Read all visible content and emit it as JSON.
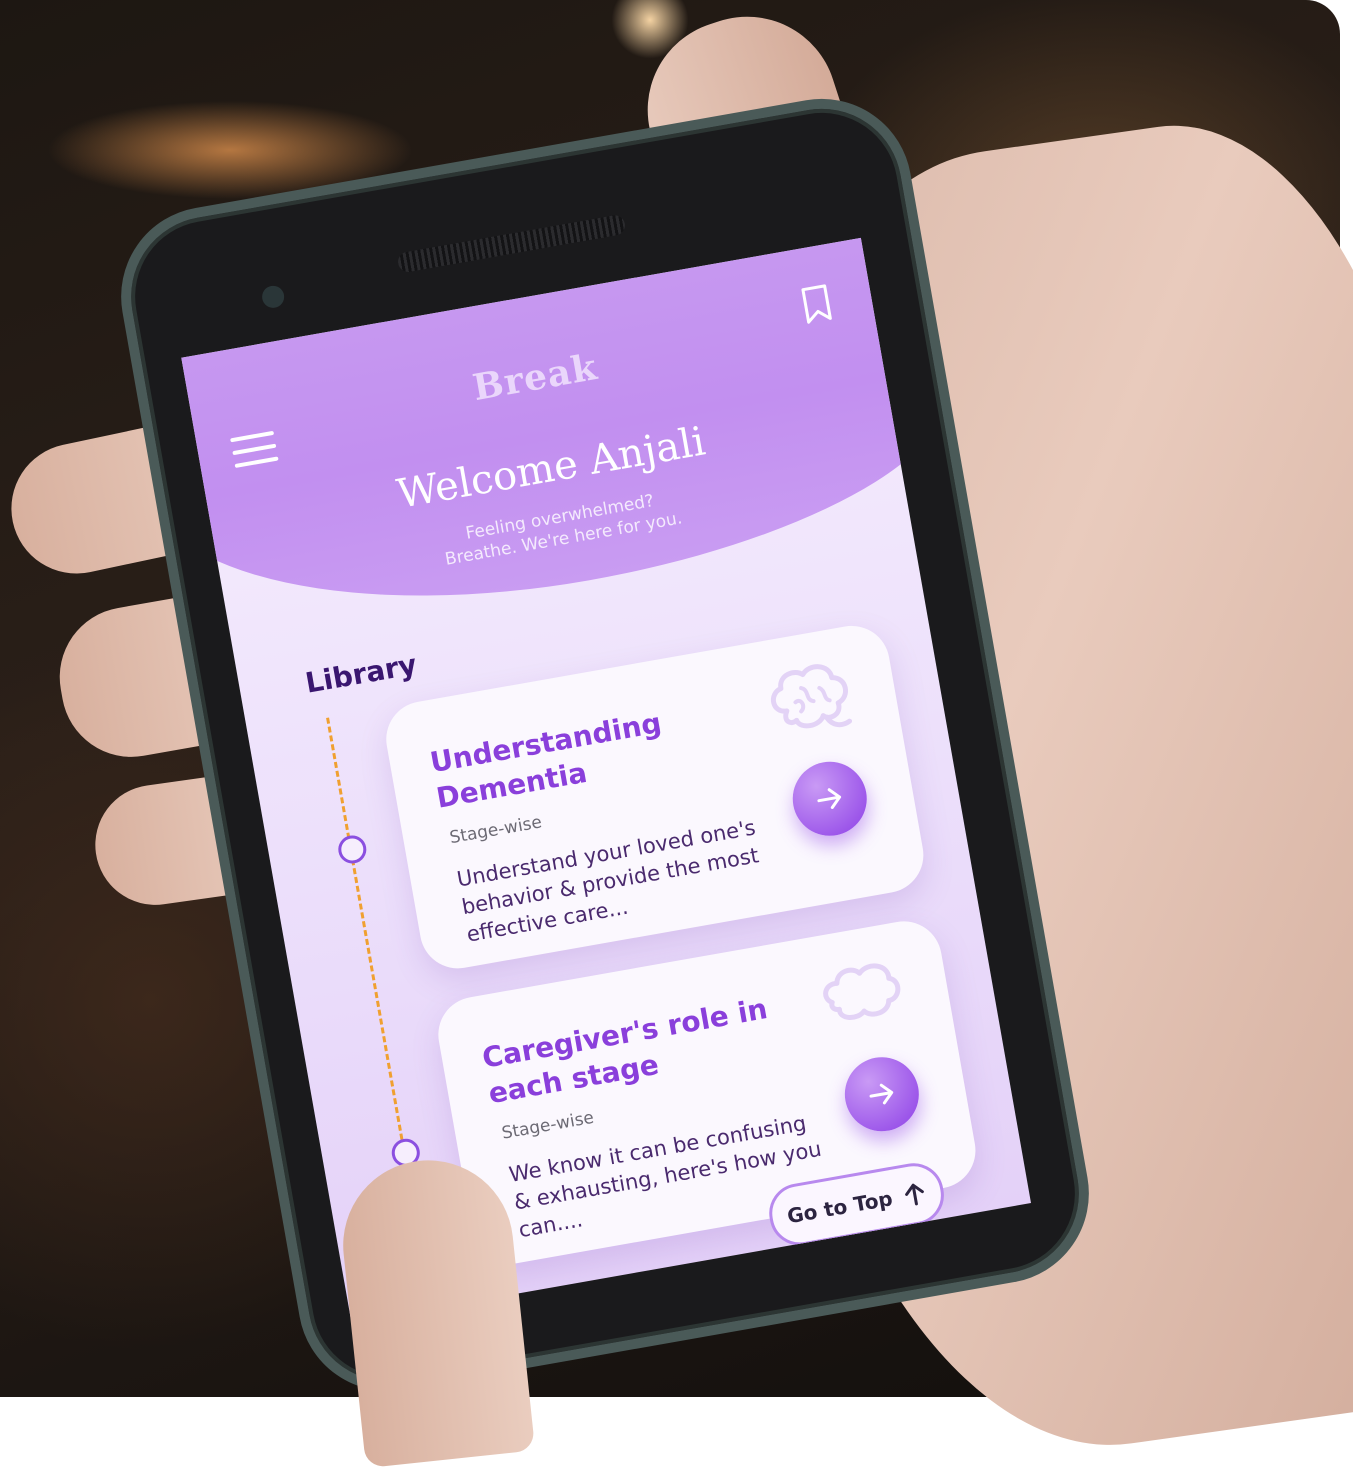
{
  "app": {
    "brand": "Break"
  },
  "header": {
    "welcome": "Welcome Anjali",
    "subtitle_line1": "Feeling overwhelmed?",
    "subtitle_line2": "Breathe. We're here for you."
  },
  "library": {
    "heading": "Library",
    "cards": [
      {
        "title": "Understanding Dementia",
        "tag": "Stage-wise",
        "description": "Understand your loved one's behavior & provide the most effective care...",
        "icon": "brain-icon"
      },
      {
        "title": "Caregiver's role in each stage",
        "tag": "Stage-wise",
        "description": "We know it can be confusing & exhausting, here's how you can....",
        "icon": "brain-outline-icon"
      }
    ]
  },
  "footer": {
    "go_top_label": "Go to Top"
  },
  "colors": {
    "accent": "#8d3fe6",
    "hero": "#c28ff0",
    "timeline": "#f0a030",
    "heading": "#3a1670"
  }
}
